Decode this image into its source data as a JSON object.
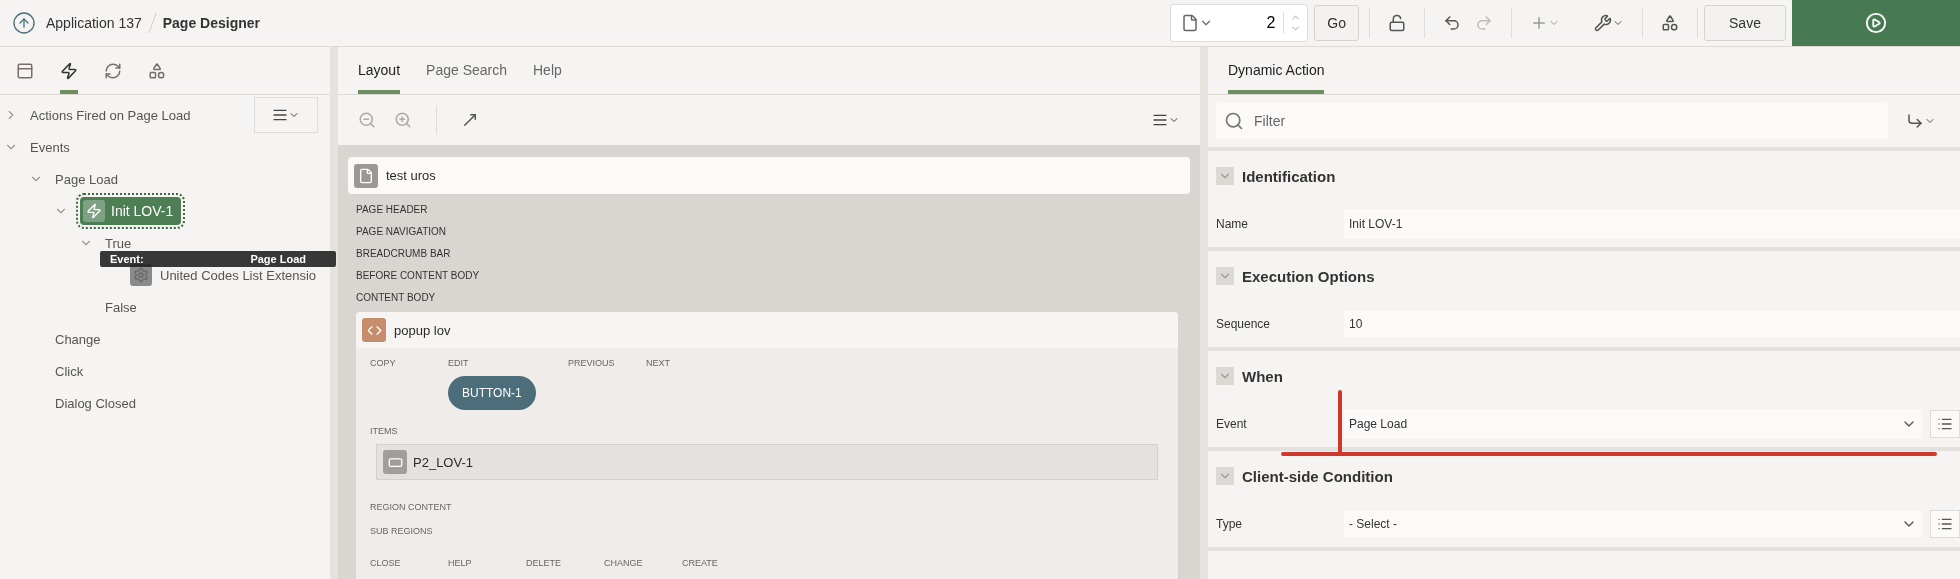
{
  "header": {
    "breadcrumb": [
      "Application 137",
      "Page Designer"
    ],
    "page_number": "2",
    "go": "Go",
    "save": "Save"
  },
  "left_panel": {
    "tabs": [
      {
        "kind": "rendering",
        "selected": false
      },
      {
        "kind": "dynamic",
        "selected": true
      },
      {
        "kind": "processing",
        "selected": false
      },
      {
        "kind": "shared",
        "selected": false
      }
    ],
    "tree": [
      {
        "label": "Actions Fired on Page Load",
        "expanded": false
      },
      {
        "label": "Events",
        "expanded": true,
        "children": [
          {
            "label": "Page Load",
            "expanded": true,
            "children": [
              {
                "label": "Init LOV-1",
                "kind": "action",
                "selected": true,
                "expanded": true,
                "children": [
                  {
                    "label": "True",
                    "expanded": true,
                    "children": [
                      {
                        "label": "United Codes List Extensio",
                        "kind": "plugin"
                      }
                    ]
                  },
                  {
                    "label": "False"
                  }
                ]
              }
            ]
          },
          {
            "label": "Change"
          },
          {
            "label": "Click"
          },
          {
            "label": "Dialog Closed"
          }
        ]
      }
    ],
    "tooltip": {
      "label": "Event:",
      "value": "Page Load"
    }
  },
  "middle_panel": {
    "tabs": [
      {
        "label": "Layout",
        "selected": true
      },
      {
        "label": "Page Search",
        "selected": false
      },
      {
        "label": "Help",
        "selected": false
      }
    ],
    "page_title": "test uros",
    "positions": [
      "PAGE HEADER",
      "PAGE NAVIGATION",
      "BREADCRUMB BAR",
      "BEFORE CONTENT BODY",
      "CONTENT BODY"
    ],
    "region": {
      "title": "popup lov",
      "button_positions": [
        "COPY",
        "EDIT",
        "PREVIOUS",
        "NEXT"
      ],
      "button": "BUTTON-1",
      "items_label": "ITEMS",
      "item": "P2_LOV-1",
      "sections": [
        "REGION CONTENT",
        "SUB REGIONS"
      ],
      "bottom_positions": [
        "CLOSE",
        "HELP",
        "DELETE",
        "CHANGE",
        "CREATE"
      ]
    }
  },
  "right_panel": {
    "tabs": [
      {
        "label": "Dynamic Action",
        "selected": true
      }
    ],
    "filter": {
      "placeholder": "Filter"
    },
    "sections": [
      {
        "title": "Identification",
        "expanded": true,
        "fields": [
          {
            "label": "Name",
            "value": "Init LOV-1",
            "kind": "text"
          }
        ]
      },
      {
        "title": "Execution Options",
        "expanded": true,
        "fields": [
          {
            "label": "Sequence",
            "value": "10",
            "kind": "text"
          }
        ]
      },
      {
        "title": "When",
        "expanded": true,
        "fields": [
          {
            "label": "Event",
            "value": "Page Load",
            "kind": "select"
          }
        ]
      },
      {
        "title": "Client-side Condition",
        "expanded": true,
        "fields": [
          {
            "label": "Type",
            "value": "- Select -",
            "kind": "select"
          }
        ]
      }
    ]
  }
}
